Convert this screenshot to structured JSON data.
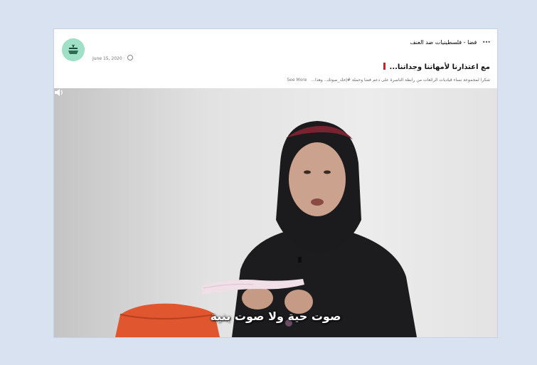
{
  "post": {
    "page_name": "فضا - فلسطينيات ضد العنف",
    "date": "June 15, 2020 ·",
    "title": "مع اعتذارنا لأمهاتنا وجداتنا...",
    "caption": "شكرا لمجموعة نساء قياديات الرائعات من رابطة الناصرة على دعم فضا وحملة #إحك_صوتك.. وهذا...",
    "see_more": "See More",
    "icons": {
      "more": "more-dots-icon",
      "privacy": "globe-icon",
      "volume": "speaker-icon"
    }
  },
  "video": {
    "subtitle": "صوت حية ولا صوت بنية"
  },
  "colors": {
    "background": "#d9e2f1",
    "avatar": "#9fe0c6",
    "accent_bar": "#c0272d"
  }
}
